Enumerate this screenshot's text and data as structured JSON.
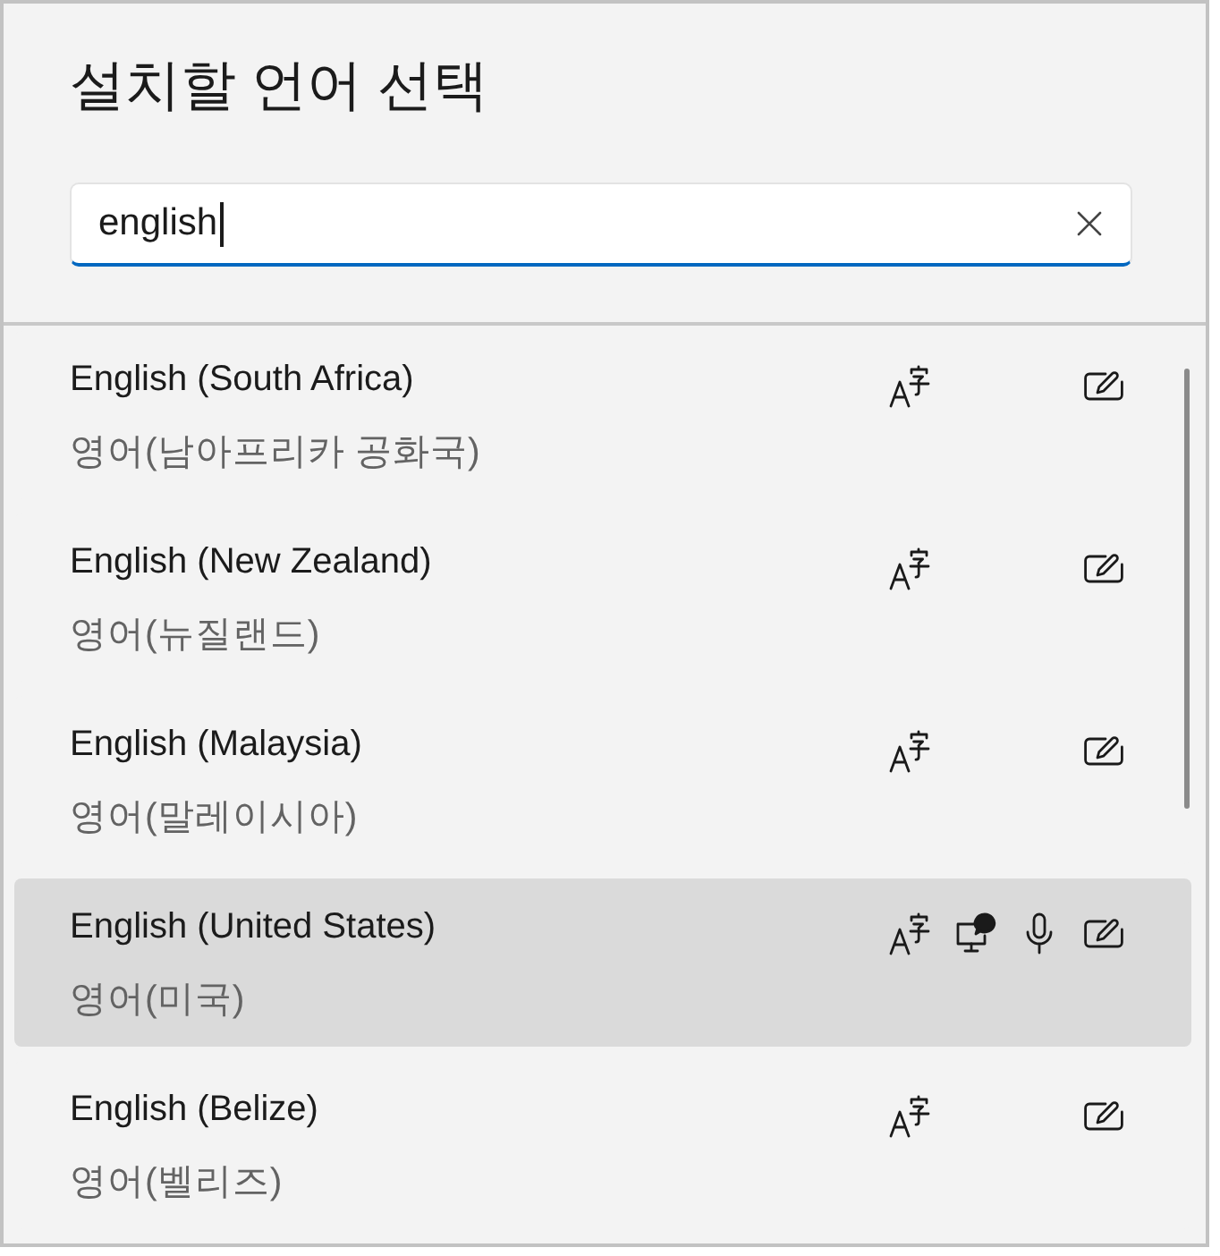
{
  "dialog": {
    "title": "설치할 언어 선택"
  },
  "search": {
    "value": "english",
    "focused": true
  },
  "languages": [
    {
      "name": "English (South Africa)",
      "localized_name": "영어(남아프리카 공화국)",
      "selected": false,
      "language_pack": true,
      "text_to_speech": false,
      "speech_recognition": false,
      "handwriting": true
    },
    {
      "name": "English (New Zealand)",
      "localized_name": "영어(뉴질랜드)",
      "selected": false,
      "language_pack": true,
      "text_to_speech": false,
      "speech_recognition": false,
      "handwriting": true
    },
    {
      "name": "English (Malaysia)",
      "localized_name": "영어(말레이시아)",
      "selected": false,
      "language_pack": true,
      "text_to_speech": false,
      "speech_recognition": false,
      "handwriting": true
    },
    {
      "name": "English (United States)",
      "localized_name": "영어(미국)",
      "selected": true,
      "language_pack": true,
      "text_to_speech": true,
      "speech_recognition": true,
      "handwriting": true
    },
    {
      "name": "English (Belize)",
      "localized_name": "영어(벨리즈)",
      "selected": false,
      "language_pack": true,
      "text_to_speech": false,
      "speech_recognition": false,
      "handwriting": true
    }
  ]
}
